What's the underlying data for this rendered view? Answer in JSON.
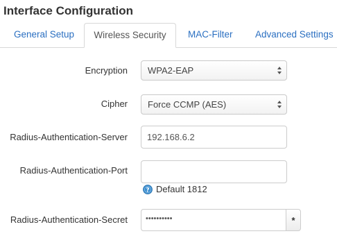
{
  "page_title": "Interface Configuration",
  "tabs": [
    {
      "label": "General Setup",
      "active": false
    },
    {
      "label": "Wireless Security",
      "active": true
    },
    {
      "label": "MAC-Filter",
      "active": false
    },
    {
      "label": "Advanced Settings",
      "active": false
    }
  ],
  "form": {
    "encryption": {
      "label": "Encryption",
      "value": "WPA2-EAP"
    },
    "cipher": {
      "label": "Cipher",
      "value": "Force CCMP (AES)"
    },
    "radius_server": {
      "label": "Radius-Authentication-Server",
      "value": "192.168.6.2"
    },
    "radius_port": {
      "label": "Radius-Authentication-Port",
      "value": "",
      "hint": "Default 1812",
      "hint_icon": "help-icon"
    },
    "radius_secret": {
      "label": "Radius-Authentication-Secret",
      "value": "••••••••••",
      "reveal_label": "*"
    }
  },
  "colors": {
    "link": "#2a6fc1",
    "help_icon": "#3b8ed0"
  }
}
